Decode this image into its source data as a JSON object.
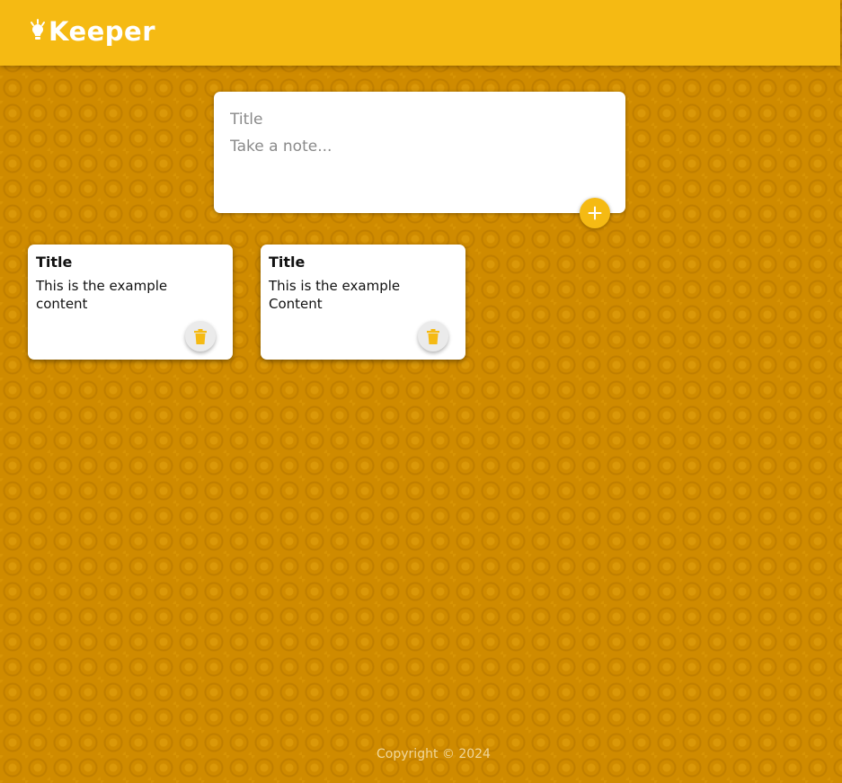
{
  "header": {
    "app_name": "Keeper",
    "logo_icon": "lightbulb-icon"
  },
  "create_note": {
    "title_placeholder": "Title",
    "content_placeholder": "Take a note...",
    "add_icon": "plus-icon"
  },
  "notes": [
    {
      "title": "Title",
      "content": "This is the example content",
      "delete_icon": "trash-icon"
    },
    {
      "title": "Title",
      "content": "This is the example Content",
      "delete_icon": "trash-icon"
    }
  ],
  "footer": {
    "copyright": "Copyright © 2024"
  },
  "colors": {
    "accent": "#f5ba13",
    "background": "#cf8b00"
  }
}
